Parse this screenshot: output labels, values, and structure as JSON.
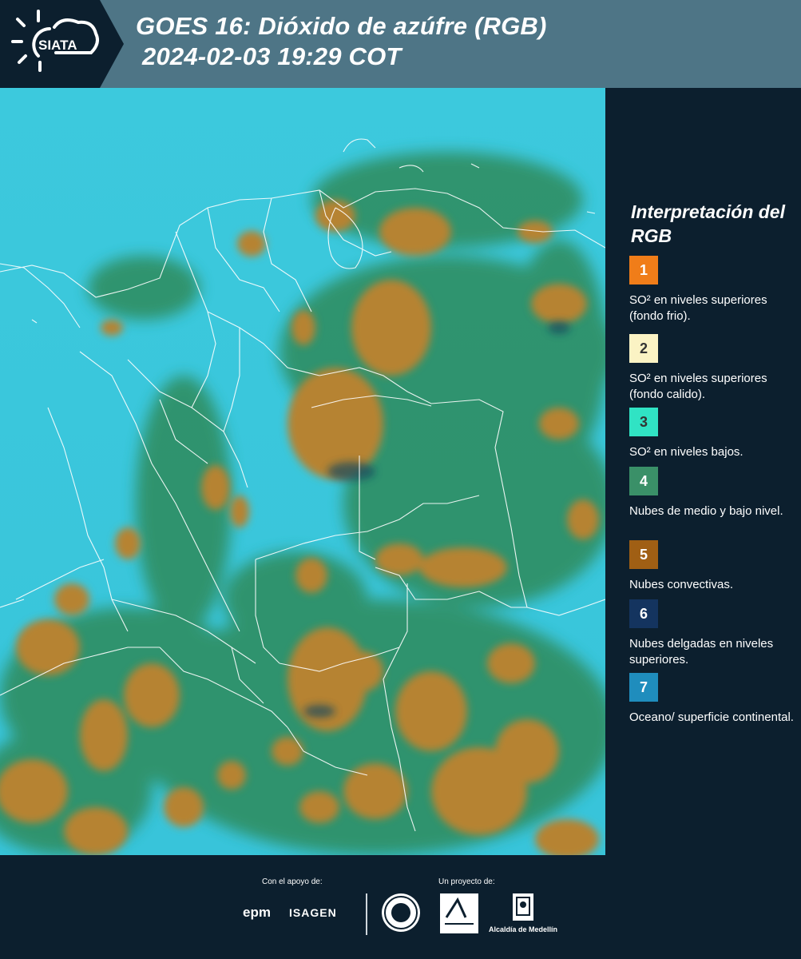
{
  "header": {
    "logo_text": "SIATA",
    "title_line1": "GOES 16: Dióxido de azúfre (RGB)",
    "title_line2": "2024-02-03 19:29 COT"
  },
  "legend": {
    "title": "Interpretación del RGB",
    "items": [
      {
        "number": "1",
        "color": "#f07d19",
        "text": "SO² en niveles superiores (fondo frio)."
      },
      {
        "number": "2",
        "color": "#fbf3c4",
        "text": "SO² en niveles superiores (fondo calido)."
      },
      {
        "number": "3",
        "color": "#30e3c4",
        "text": "SO² en niveles bajos."
      },
      {
        "number": "4",
        "color": "#3a9068",
        "text": "Nubes de medio y bajo nivel."
      },
      {
        "number": "5",
        "color": "#a05f14",
        "text": "Nubes convectivas."
      },
      {
        "number": "6",
        "color": "#14345f",
        "text": "Nubes delgadas en niveles superiores."
      },
      {
        "number": "7",
        "color": "#1f8dbd",
        "text": "Oceano/ superficie continental."
      }
    ]
  },
  "footer": {
    "support_caption": "Con el apoyo de:",
    "project_caption": "Un proyecto de:",
    "sponsor_1": "epm",
    "sponsor_2": "ISAGEN",
    "partner_label": "Alcaldía de Medellín"
  },
  "colors": {
    "header_bg": "#4e7586",
    "panel_bg": "#0c1f2e",
    "map_base": "#34c6dc",
    "cloud_orange": "#b4832e",
    "cloud_green": "#2e8a5a"
  }
}
